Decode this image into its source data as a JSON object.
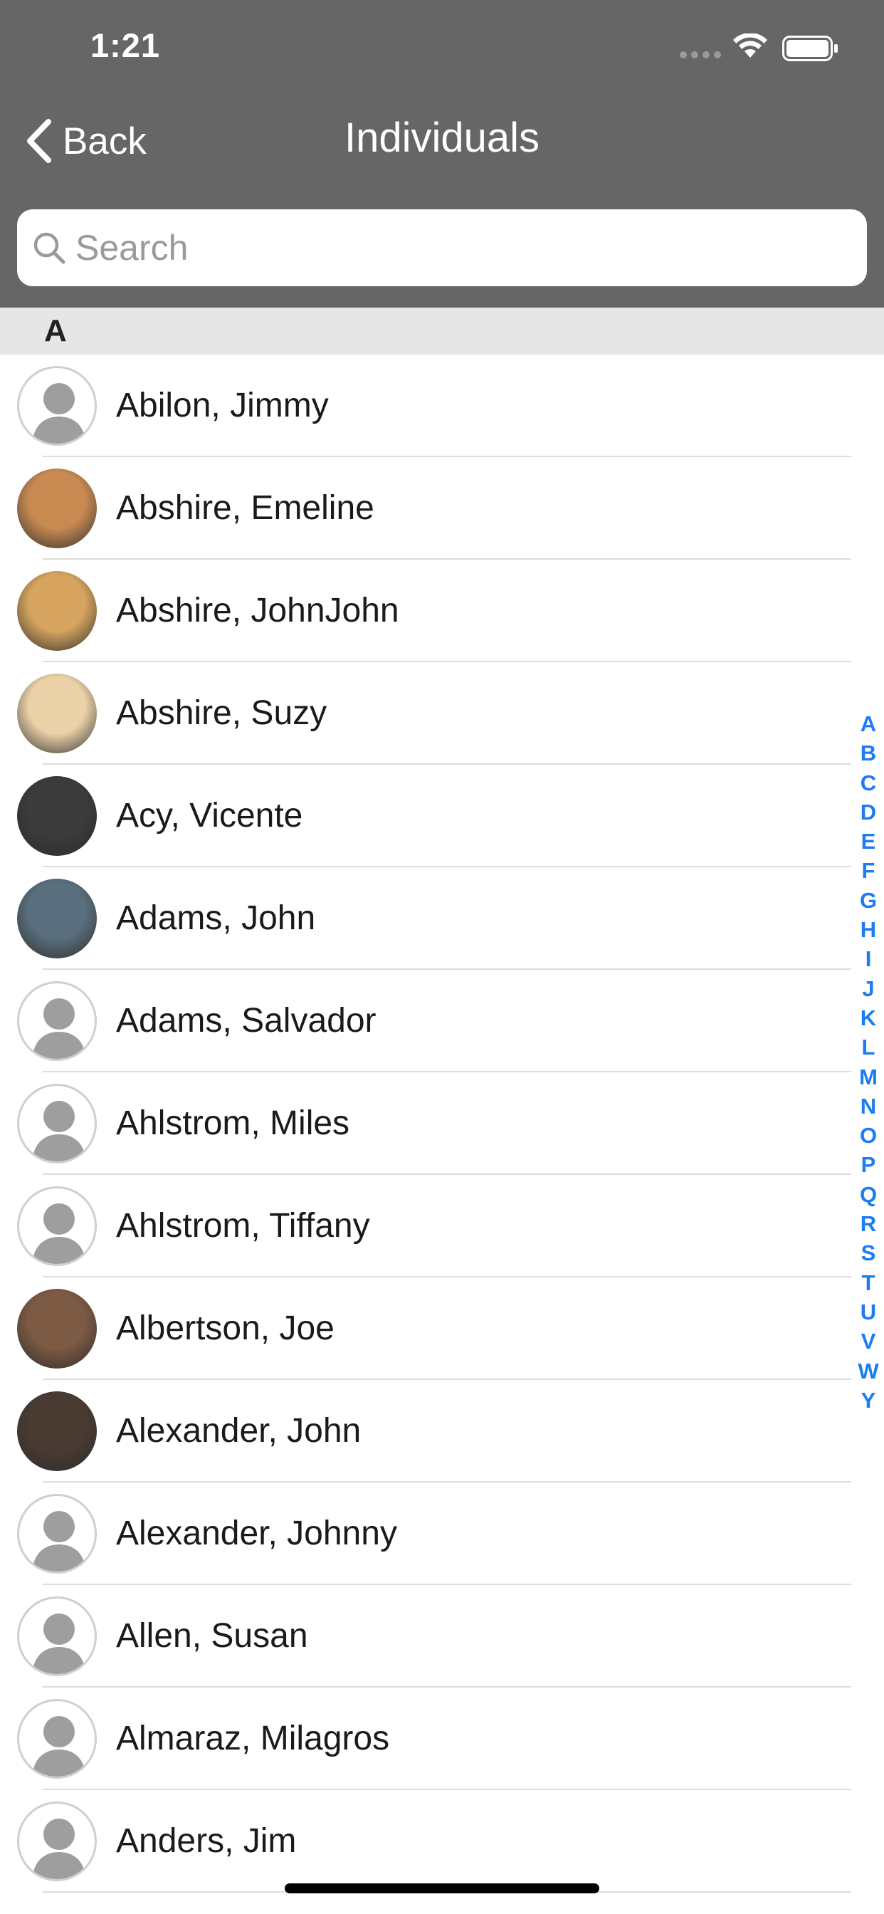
{
  "status_bar": {
    "time": "1:21"
  },
  "nav": {
    "back_label": "Back",
    "title": "Individuals"
  },
  "search": {
    "placeholder": "Search",
    "value": ""
  },
  "section": {
    "letter": "A"
  },
  "contacts": [
    {
      "name": "Abilon, Jimmy",
      "avatar": "placeholder-person-icon"
    },
    {
      "name": "Abshire, Emeline",
      "avatar": "photo",
      "color": "#c98a52"
    },
    {
      "name": "Abshire, JohnJohn",
      "avatar": "photo",
      "color": "#d6a45e"
    },
    {
      "name": "Abshire, Suzy",
      "avatar": "photo",
      "color": "#ecd2a8"
    },
    {
      "name": "Acy, Vicente",
      "avatar": "photo",
      "color": "#3b3b3b"
    },
    {
      "name": "Adams, John",
      "avatar": "photo",
      "color": "#5a6f7e"
    },
    {
      "name": "Adams, Salvador",
      "avatar": "placeholder-person-icon"
    },
    {
      "name": "Ahlstrom, Miles",
      "avatar": "placeholder-person-icon"
    },
    {
      "name": "Ahlstrom, Tiffany",
      "avatar": "placeholder-person-icon"
    },
    {
      "name": "Albertson, Joe",
      "avatar": "photo",
      "color": "#7d5a44"
    },
    {
      "name": "Alexander, John",
      "avatar": "photo",
      "color": "#4a3b32"
    },
    {
      "name": "Alexander, Johnny",
      "avatar": "placeholder-person-icon"
    },
    {
      "name": "Allen, Susan",
      "avatar": "placeholder-person-icon"
    },
    {
      "name": "Almaraz, Milagros",
      "avatar": "placeholder-person-icon"
    },
    {
      "name": "Anders, Jim",
      "avatar": "placeholder-person-icon"
    }
  ],
  "index_letters": [
    "A",
    "B",
    "C",
    "D",
    "E",
    "F",
    "G",
    "H",
    "I",
    "J",
    "K",
    "L",
    "M",
    "N",
    "O",
    "P",
    "Q",
    "R",
    "S",
    "T",
    "U",
    "V",
    "W",
    "Y"
  ],
  "colors": {
    "header": "#666666",
    "accent": "#1c7cf2",
    "section": "#e6e6e6",
    "placeholder_avatar": "#9e9e9e"
  }
}
